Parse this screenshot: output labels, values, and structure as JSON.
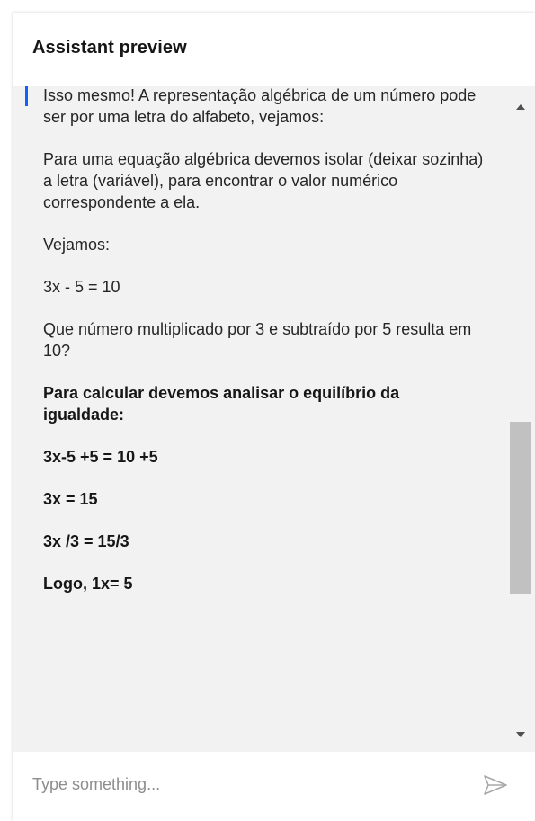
{
  "header": {
    "title": "Assistant preview"
  },
  "message": {
    "paragraphs": [
      {
        "text": "Isso mesmo! A representação algébrica de um número pode ser por uma letra do alfabeto, vejamos:",
        "bold": false
      },
      {
        "text": "Para uma equação algébrica devemos isolar (deixar sozinha) a letra (variável), para encontrar o valor numérico correspondente a ela.",
        "bold": false
      },
      {
        "text": "Vejamos:",
        "bold": false
      },
      {
        "text": "3x - 5 = 10",
        "bold": false
      },
      {
        "text": "Que número multiplicado por 3 e subtraído por 5 resulta em 10?",
        "bold": false
      },
      {
        "text": "Para calcular devemos analisar o equilíbrio da igualdade:",
        "bold": true
      },
      {
        "text": "3x-5 +5 = 10 +5",
        "bold": true
      },
      {
        "text": "3x = 15",
        "bold": true
      },
      {
        "text": "3x /3 = 15/3",
        "bold": true
      },
      {
        "text": "Logo, 1x= 5",
        "bold": true
      }
    ]
  },
  "input": {
    "placeholder": "Type something..."
  },
  "icons": {
    "send": "send-icon",
    "scroll_up": "chevron-up-icon",
    "scroll_down": "chevron-down-icon"
  },
  "colors": {
    "accent": "#0f62fe",
    "panel_bg": "#f2f2f2"
  }
}
